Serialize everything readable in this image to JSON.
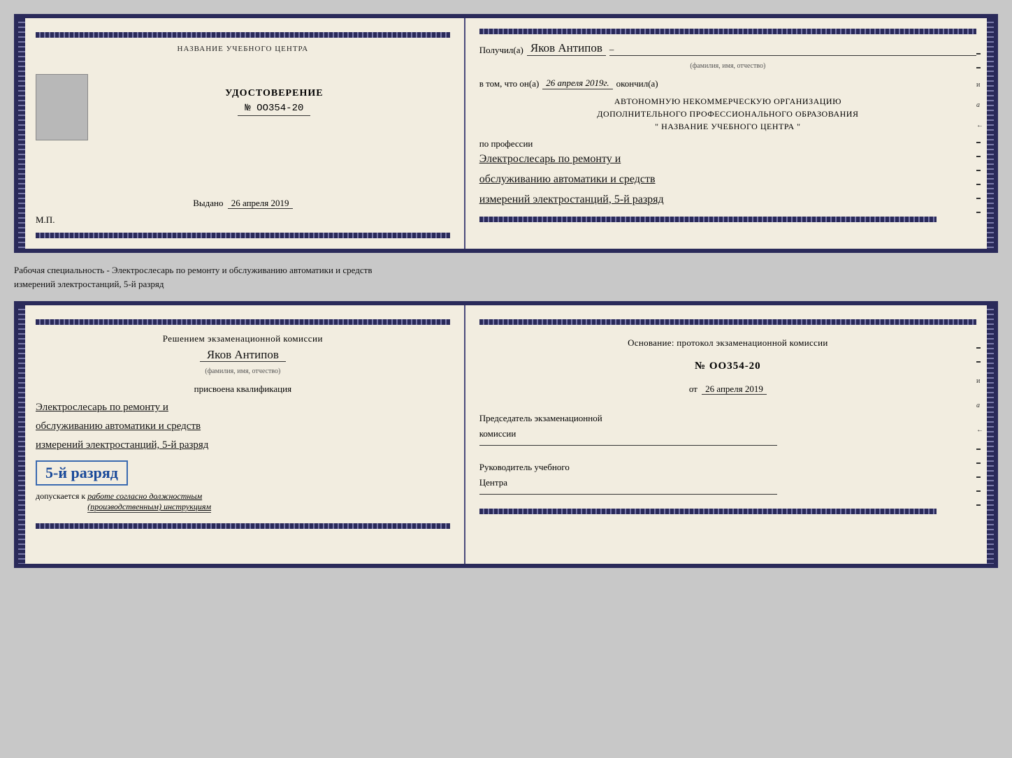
{
  "top_book": {
    "left_page": {
      "header": "НАЗВАНИЕ УЧЕБНОГО ЦЕНТРА",
      "photo_label": "",
      "cert_title": "УДОСТОВЕРЕНИЕ",
      "cert_number": "№ ОО354-20",
      "issued_label": "Выдано",
      "issued_date": "26 апреля 2019",
      "mp_label": "М.П."
    },
    "right_page": {
      "received_label": "Получил(а)",
      "received_name": "Яков Антипов",
      "fio_label": "(фамилия, имя, отчество)",
      "vtom_label": "в том, что он(а)",
      "date_value": "26 апреля 2019г.",
      "finished_label": "окончил(а)",
      "org_line1": "АВТОНОМНУЮ НЕКОММЕРЧЕСКУЮ ОРГАНИЗАЦИЮ",
      "org_line2": "ДОПОЛНИТЕЛЬНОГО ПРОФЕССИОНАЛЬНОГО ОБРАЗОВАНИЯ",
      "org_line3": "\"  НАЗВАНИЕ УЧЕБНОГО ЦЕНТРА  \"",
      "profession_label": "по профессии",
      "profession_text1": "Электрослесарь по ремонту и",
      "profession_text2": "обслуживанию автоматики и средств",
      "profession_text3": "измерений электростанций, 5-й разряд"
    }
  },
  "middle_text": "Рабочая специальность - Электрослесарь по ремонту и обслуживанию автоматики и средств\nизмерений электростанций, 5-й разряд",
  "bottom_book": {
    "left_page": {
      "decision_label": "Решением экзаменационной комиссии",
      "person_name": "Яков Антипов",
      "fio_label": "(фамилия, имя, отчество)",
      "assigned_label": "присвоена квалификация",
      "qual_text1": "Электрослесарь по ремонту и",
      "qual_text2": "обслуживанию автоматики и средств",
      "qual_text3": "измерений электростанций, 5-й разряд",
      "rank_stamp": "5-й разряд",
      "allowed_label": "допускается к",
      "allowed_text": "работе согласно должностным\n(производственным) инструкциям"
    },
    "right_page": {
      "basis_label": "Основание: протокол экзаменационной комиссии",
      "protocol_number": "№  ОО354-20",
      "date_from_label": "от",
      "date_value": "26 апреля 2019",
      "chairman_label": "Председатель экзаменационной\nкомиссии",
      "director_label": "Руководитель учебного\nЦентра"
    }
  }
}
